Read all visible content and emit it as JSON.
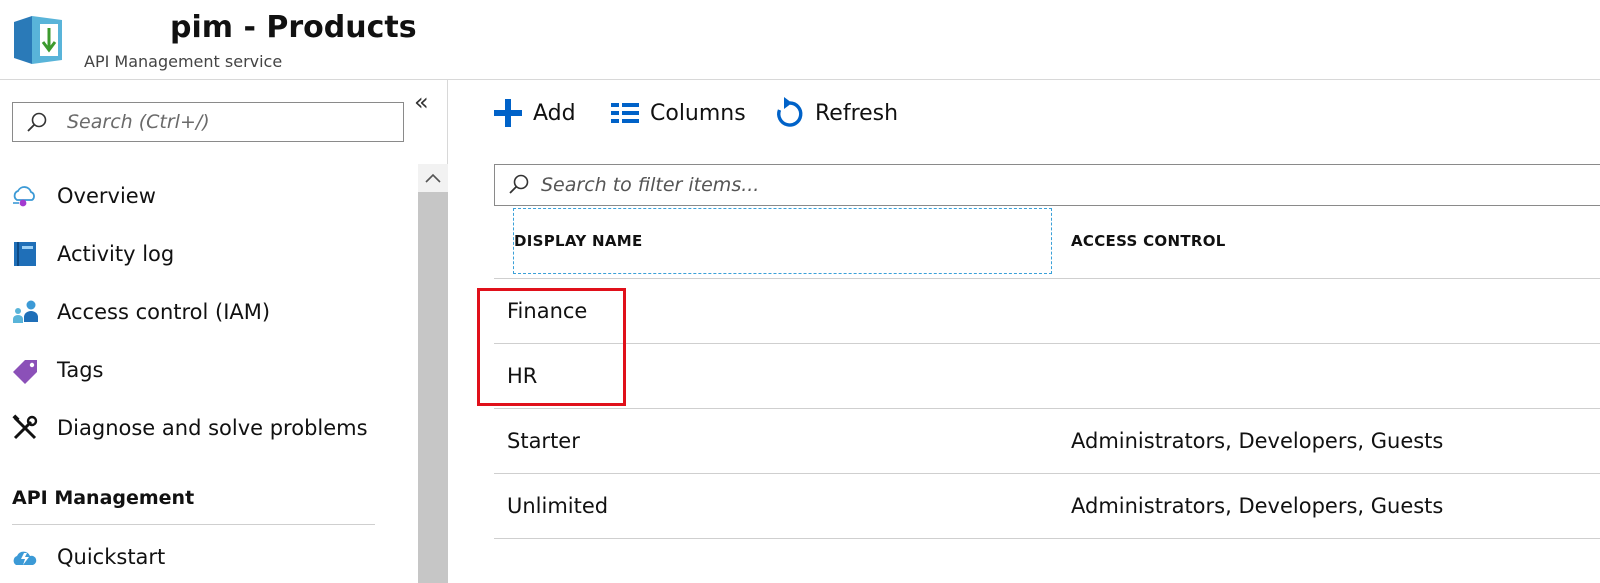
{
  "header": {
    "title": "pim - Products",
    "subtitle": "API Management service"
  },
  "sidebar": {
    "search_placeholder": "Search (Ctrl+/)",
    "collapse_glyph": "«",
    "items": [
      {
        "label": "Overview",
        "icon": "overview-cloud-icon"
      },
      {
        "label": "Activity log",
        "icon": "activity-log-icon"
      },
      {
        "label": "Access control (IAM)",
        "icon": "access-control-icon"
      },
      {
        "label": "Tags",
        "icon": "tag-icon"
      },
      {
        "label": "Diagnose and solve problems",
        "icon": "wrench-tools-icon"
      }
    ],
    "section_title": "API Management",
    "section_items": [
      {
        "label": "Quickstart",
        "icon": "quickstart-cloud-icon"
      }
    ]
  },
  "toolbar": {
    "add_label": "Add",
    "columns_label": "Columns",
    "refresh_label": "Refresh"
  },
  "filter": {
    "placeholder": "Search to filter items..."
  },
  "table": {
    "headers": [
      "DISPLAY NAME",
      "ACCESS CONTROL"
    ],
    "rows": [
      {
        "name": "Finance",
        "access": ""
      },
      {
        "name": "HR",
        "access": ""
      },
      {
        "name": "Starter",
        "access": "Administrators, Developers, Guests"
      },
      {
        "name": "Unlimited",
        "access": "Administrators, Developers, Guests"
      }
    ]
  },
  "colors": {
    "accent": "#0062c8",
    "highlight": "#e0101a",
    "focus_border": "#3aa0d8"
  }
}
